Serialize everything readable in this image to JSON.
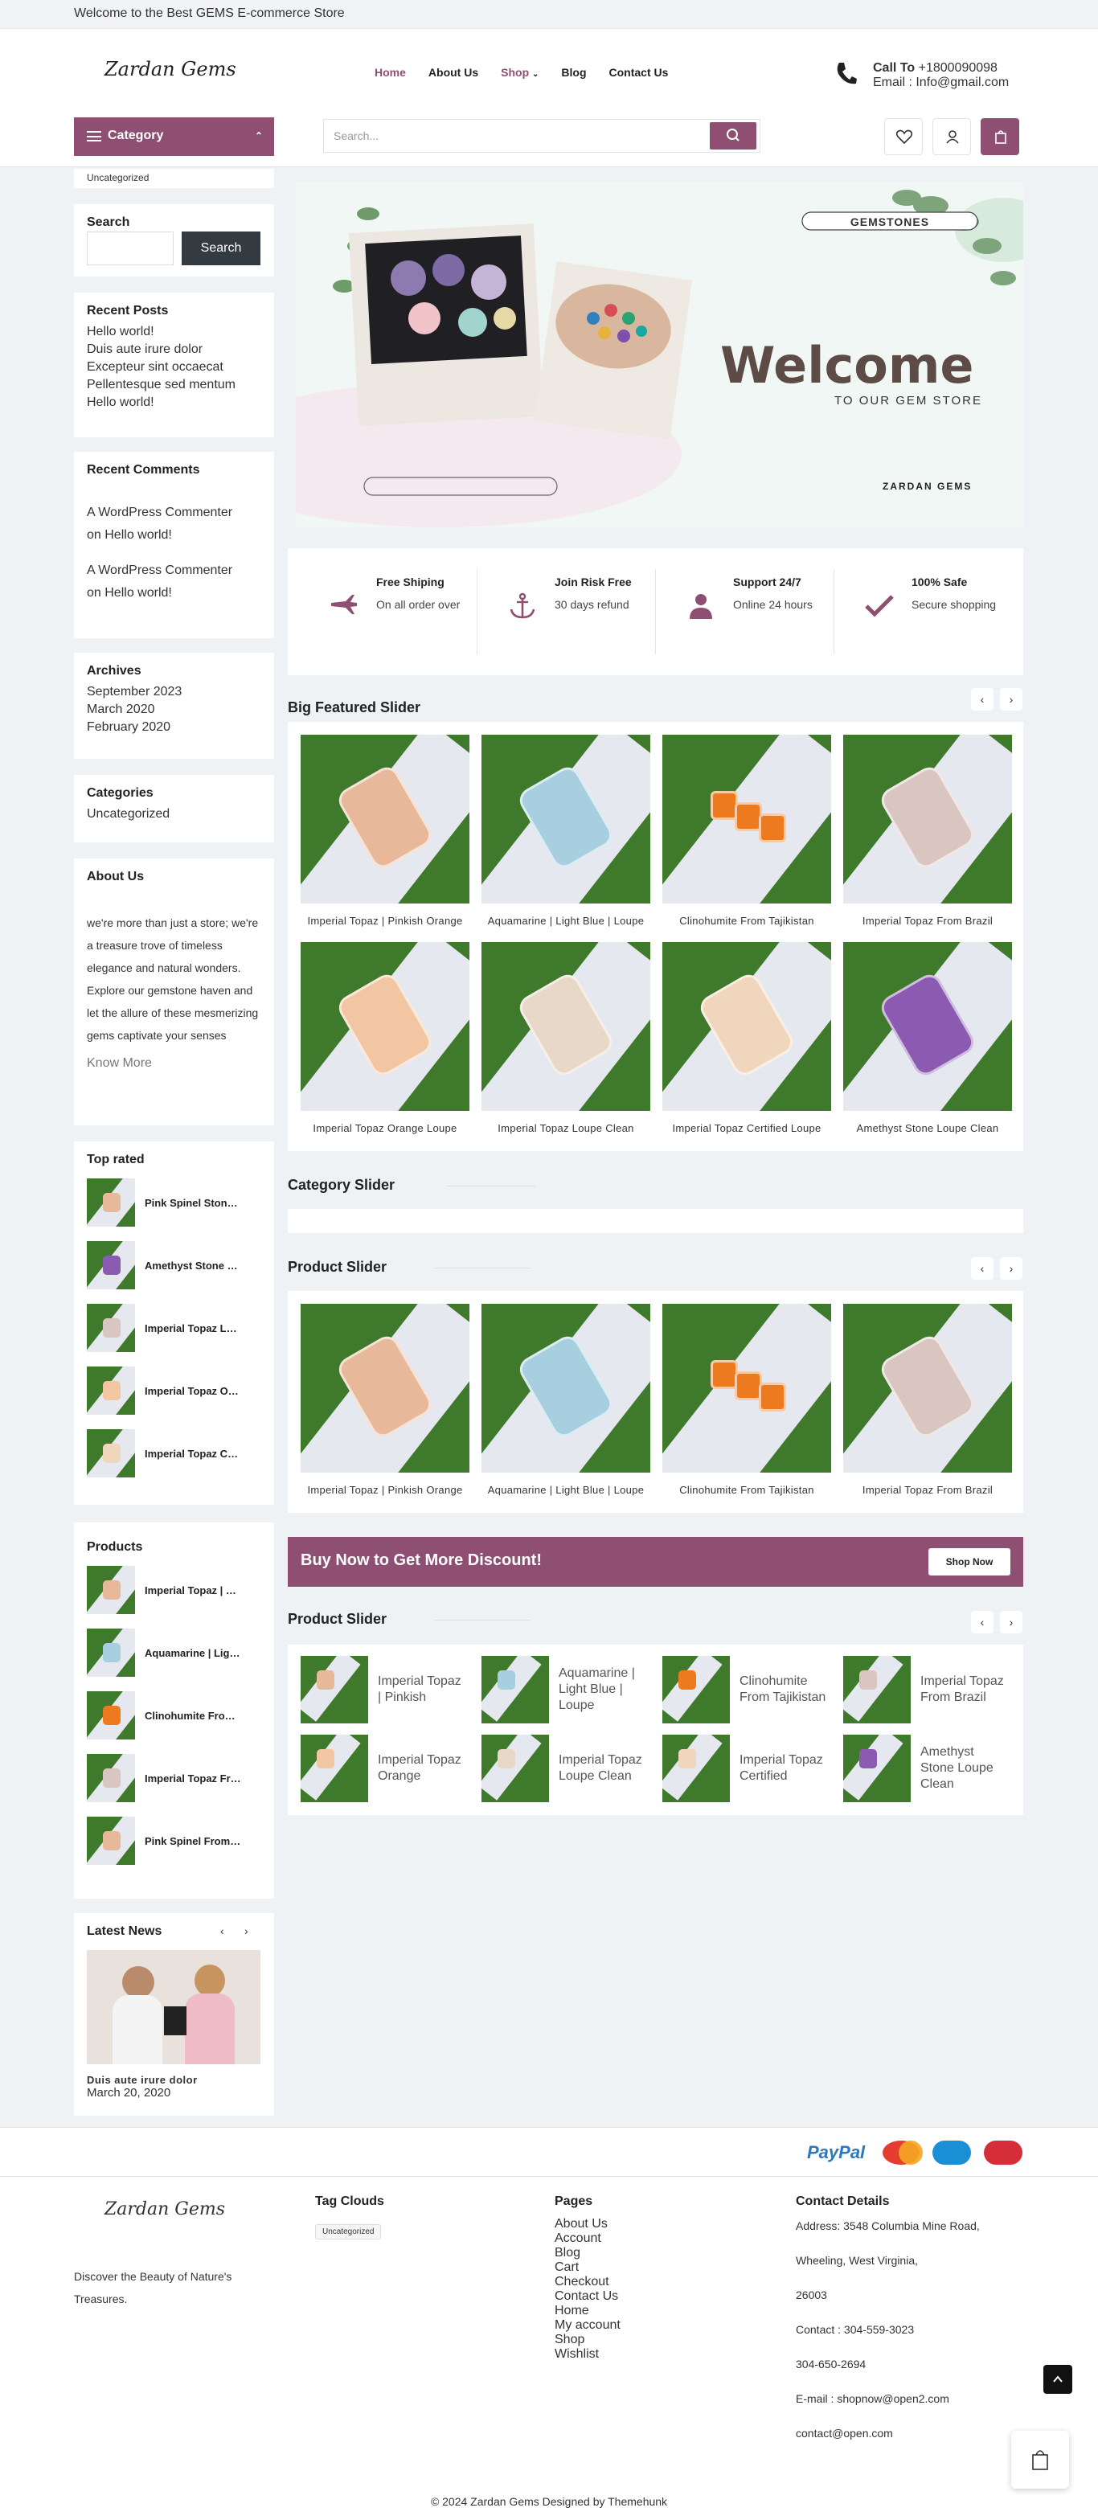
{
  "topbar": {
    "text": "Welcome to the Best GEMS E-commerce Store"
  },
  "header": {
    "logo": "Zardan Gems",
    "nav": [
      "Home",
      "About Us",
      "Shop",
      "Blog",
      "Contact Us"
    ],
    "call_label": "Call To",
    "call_number": "+1800090098",
    "email": "Email : Info@gmail.com"
  },
  "subbar": {
    "category": "Category",
    "search_placeholder": "Search..."
  },
  "sidebar": {
    "category_item": "Uncategorized",
    "search_title": "Search",
    "search_button": "Search",
    "recent_posts_title": "Recent Posts",
    "recent_posts": [
      "Hello world!",
      "Duis aute irure dolor",
      "Excepteur sint occaecat",
      "Pellentesque sed mentum",
      "Hello world!"
    ],
    "recent_comments_title": "Recent Comments",
    "comments": [
      {
        "author": "A WordPress Commenter",
        "on": "on",
        "post": "Hello world!"
      },
      {
        "author": "A WordPress Commenter",
        "on": "on",
        "post": "Hello world!"
      }
    ],
    "archives_title": "Archives",
    "archives": [
      "September 2023",
      "March 2020",
      "February 2020"
    ],
    "categories_title": "Categories",
    "categories": [
      "Uncategorized"
    ],
    "about_title": "About Us",
    "about_text": "we're more than just a store; we're a treasure trove of timeless elegance and natural wonders. Explore our gemstone haven and let the allure of these mesmerizing gems captivate your senses",
    "know_more": "Know More",
    "top_rated_title": "Top rated",
    "top_rated": [
      "Pink Spinel Stone Loupe Clean",
      "Amethyst Stone Loupe Clean",
      "Imperial Topaz Loupe Clean",
      "Imperial Topaz Orange",
      "Imperial Topaz Certified"
    ],
    "products_title": "Products",
    "products": [
      "Imperial Topaz | Pinkish",
      "Aquamarine | Light Blue",
      "Clinohumite From Tajikistan",
      "Imperial Topaz From Brazil",
      "Pink Spinel From Burma"
    ],
    "latest_news_title": "Latest News",
    "news_title": "Duis aute irure dolor",
    "news_date": "March 20, 2020"
  },
  "banner": {
    "tag": "GEMSTONES",
    "title": "Welcome",
    "subtitle": "TO OUR GEM STORE",
    "brand": "ZARDAN GEMS"
  },
  "features": [
    {
      "title": "Free Shiping",
      "sub": "On all order over",
      "icon": "plane-icon"
    },
    {
      "title": "Join Risk Free",
      "sub": "30 days refund",
      "icon": "anchor-icon"
    },
    {
      "title": "Support 24/7",
      "sub": "Online 24 hours",
      "icon": "user-icon"
    },
    {
      "title": "100% Safe",
      "sub": "Secure shopping",
      "icon": "check-icon"
    }
  ],
  "big_featured": {
    "title": "Big Featured Slider",
    "items": [
      "Imperial Topaz | Pinkish Orange",
      "Aquamarine | Light Blue | Loupe",
      "Clinohumite From Tajikistan",
      "Imperial Topaz From Brazil",
      "Imperial Topaz Orange Loupe",
      "Imperial Topaz Loupe Clean",
      "Imperial Topaz Certified Loupe",
      "Amethyst Stone Loupe Clean"
    ]
  },
  "category_slider": {
    "title": "Category Slider"
  },
  "product_slider": {
    "title": "Product Slider",
    "items": [
      "Imperial Topaz | Pinkish Orange",
      "Aquamarine | Light Blue | Loupe",
      "Clinohumite From Tajikistan",
      "Imperial Topaz From Brazil"
    ]
  },
  "discount": {
    "text": "Buy Now to Get More Discount!",
    "button": "Shop Now"
  },
  "product_slider2": {
    "title": "Product Slider",
    "items": [
      "Imperial Topaz | Pinkish",
      "Aquamarine | Light Blue | Loupe",
      "Clinohumite From Tajikistan",
      "Imperial Topaz From Brazil",
      "Imperial Topaz Orange",
      "Imperial Topaz Loupe Clean",
      "Imperial Topaz Certified",
      "Amethyst Stone Loupe Clean"
    ]
  },
  "payments": [
    "PayPal",
    "MasterCard",
    "Cirrus",
    "Maestro"
  ],
  "footer": {
    "tagline": "Discover the Beauty of Nature's Treasures.",
    "tag_title": "Tag Clouds",
    "tag": "Uncategorized",
    "pages_title": "Pages",
    "pages": [
      "About Us",
      "Account",
      "Blog",
      "Cart",
      "Checkout",
      "Contact Us",
      "Home",
      "My account",
      "Shop",
      "Wishlist"
    ],
    "contact_title": "Contact Details",
    "contact": [
      "Address: 3548 Columbia Mine Road,",
      "Wheeling, West Virginia,",
      "26003",
      "Contact : 304-559-3023",
      "304-650-2694",
      "E-mail : shopnow@open2.com",
      "contact@open.com"
    ],
    "copyright": "© 2024 Zardan Gems Designed by Themehunk"
  },
  "colors": {
    "accent": "#8e4f72",
    "bg": "#eef2f5"
  }
}
